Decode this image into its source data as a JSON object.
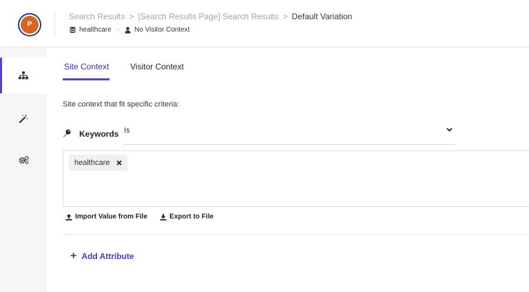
{
  "header": {
    "avatar_initial": "P",
    "breadcrumbs": [
      "Search Results",
      "[Search Results Page] Search Results",
      "Default Variation"
    ],
    "breadcrumb_separator": ">",
    "database": "healthcare",
    "visitor_context": "No Visitor Context"
  },
  "sidebar": {
    "items": [
      {
        "icon": "sitemap-icon",
        "active": true
      },
      {
        "icon": "magic-wand-icon",
        "active": false
      },
      {
        "icon": "cogs-icon",
        "active": false
      }
    ]
  },
  "tabs": [
    "Site Context",
    "Visitor Context"
  ],
  "active_tab": "Site Context",
  "description": "Site context that fit specific criteria:",
  "criteria": {
    "label": "Keywords",
    "operator": "Is",
    "values": [
      "healthcare"
    ]
  },
  "actions": {
    "import_label": "Import Value from File",
    "export_label": "Export to File",
    "add_attribute_label": "Add Attribute",
    "add_icon": "+"
  },
  "colors": {
    "accent": "#5b3fd6",
    "avatar_bg": "#d9661f",
    "avatar_ring": "#1c3f8c",
    "sidebar_bg": "#f6f6f8"
  }
}
